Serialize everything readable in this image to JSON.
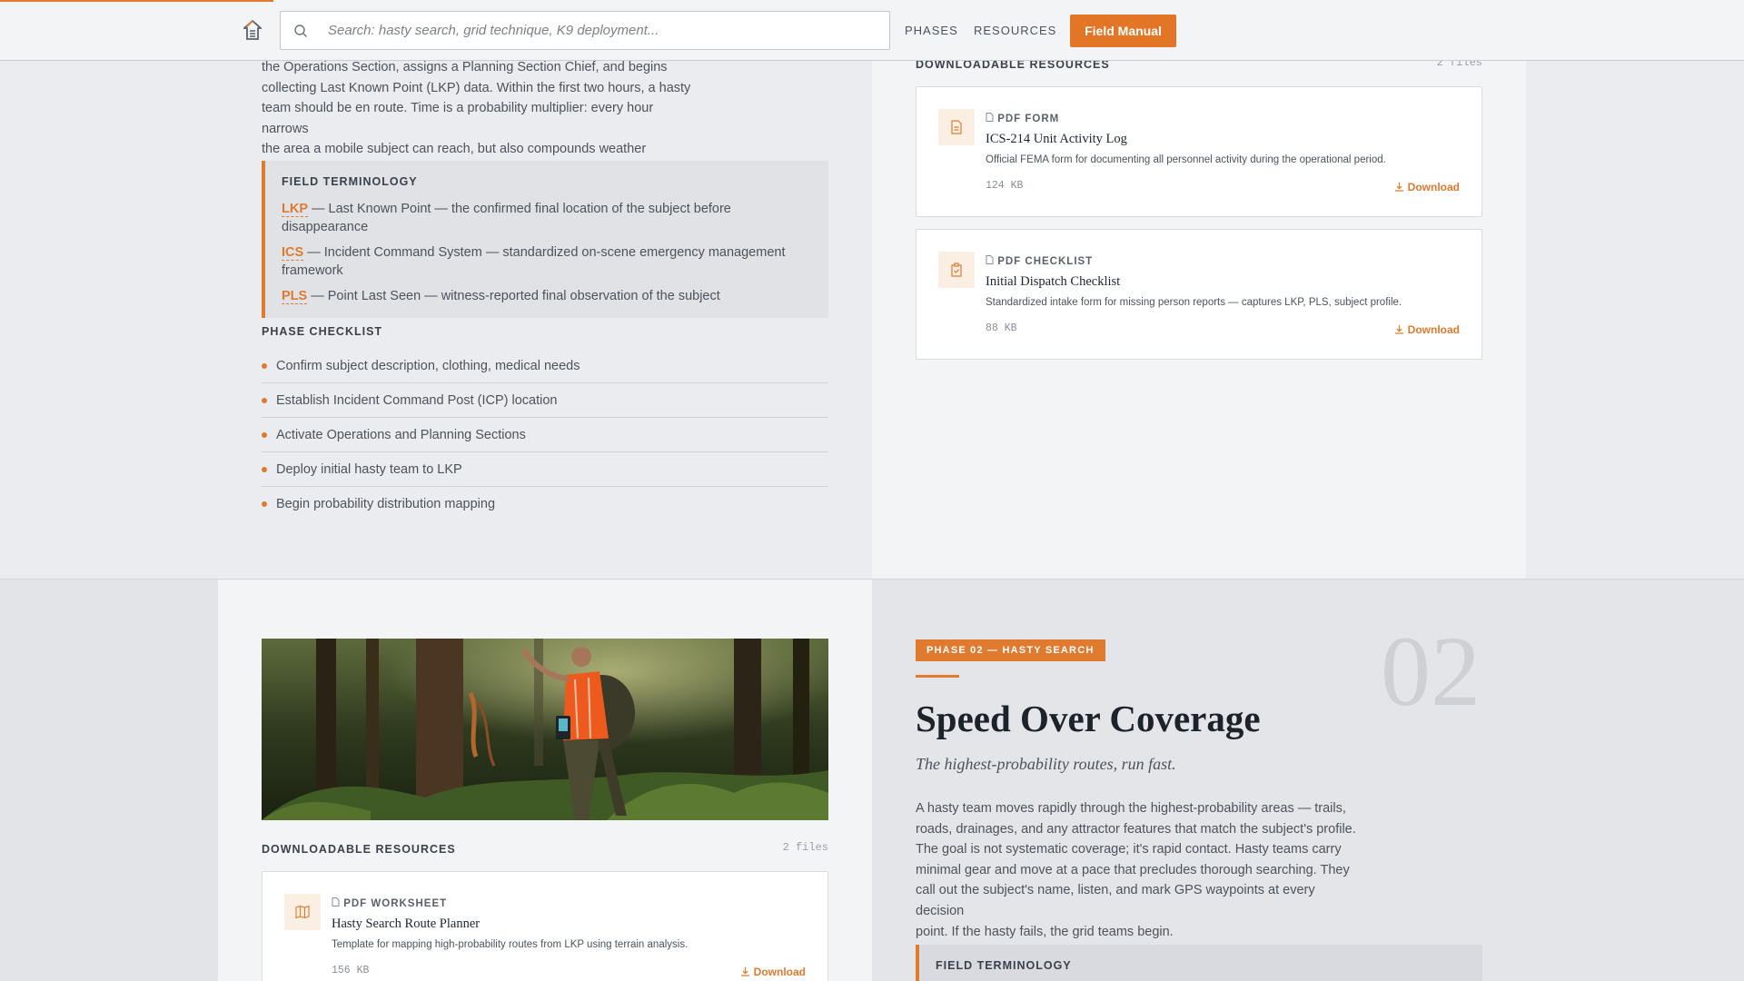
{
  "header": {
    "search_placeholder": "Search: hasty search, grid technique, K9 deployment...",
    "nav": [
      "PHASES",
      "RESOURCES"
    ],
    "cta_label": "Field Manual",
    "reading_progress": 0.157
  },
  "phase01": {
    "intro_lines": [
      "the Operations Section, assigns a Planning Section Chief, and begins",
      "collecting Last Known Point (LKP) data. Within the first two hours, a hasty",
      "team should be en route. Time is a probability multiplier: every hour narrows",
      "the area a mobile subject can reach, but also compounds weather exposure."
    ],
    "terminology": {
      "title": "FIELD TERMINOLOGY",
      "items": [
        {
          "abbr": "LKP",
          "text": " — Last Known Point — the confirmed final location of the subject before disappearance"
        },
        {
          "abbr": "ICS",
          "text": " — Incident Command System — standardized on-scene emergency management framework"
        },
        {
          "abbr": "PLS",
          "text": " — Point Last Seen — witness-reported final observation of the subject"
        }
      ]
    },
    "checklist": {
      "title": "PHASE CHECKLIST",
      "items": [
        "Confirm subject description, clothing, medical needs",
        "Establish Incident Command Post (ICP) location",
        "Activate Operations and Planning Sections",
        "Deploy initial hasty team to LKP",
        "Begin probability distribution mapping"
      ]
    },
    "resources": {
      "title": "DOWNLOADABLE RESOURCES",
      "count": "2 files",
      "items": [
        {
          "type": "PDF FORM",
          "title": "ICS-214 Unit Activity Log",
          "desc": "Official FEMA form for documenting all personnel activity during the operational period.",
          "size": "124 KB",
          "action": "Download",
          "icon": "document-icon"
        },
        {
          "type": "PDF CHECKLIST",
          "title": "Initial Dispatch Checklist",
          "desc": "Standardized intake form for missing person reports — captures LKP, PLS, subject profile.",
          "size": "88 KB",
          "action": "Download",
          "icon": "clipboard-icon"
        }
      ]
    }
  },
  "phase02": {
    "badge": "PHASE 02 — HASTY SEARCH",
    "number": "02",
    "title": "Speed Over Coverage",
    "subtitle": "The highest-probability routes, run fast.",
    "body_lines": [
      "A hasty team moves rapidly through the highest-probability areas — trails,",
      "roads, drainages, and any attractor features that match the subject's profile.",
      "The goal is not systematic coverage; it's rapid contact. Hasty teams carry",
      "minimal gear and move at a pace that precludes thorough searching. They",
      "call out the subject's name, listen, and mark GPS waypoints at every decision",
      "point. If the hasty fails, the grid teams begin."
    ],
    "terminology_title": "FIELD TERMINOLOGY",
    "resources": {
      "title": "DOWNLOADABLE RESOURCES",
      "count": "2 files",
      "items": [
        {
          "type": "PDF WORKSHEET",
          "title": "Hasty Search Route Planner",
          "desc": "Template for mapping high-probability routes from LKP using terrain analysis.",
          "size": "156 KB",
          "action": "Download",
          "icon": "map-icon"
        }
      ]
    }
  },
  "colors": {
    "accent": "#e07a2e",
    "ink": "#1d232b",
    "body": "#4c535c"
  }
}
